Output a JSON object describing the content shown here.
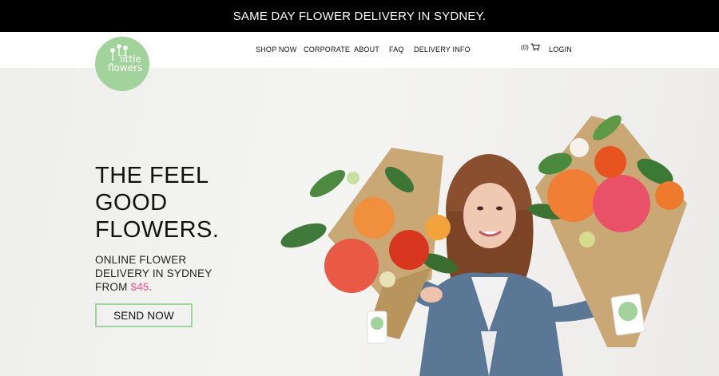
{
  "announcement": "SAME DAY FLOWER DELIVERY IN SYDNEY.",
  "logo": {
    "line1": "little",
    "line2": "flowers"
  },
  "nav": {
    "items": [
      "SHOP NOW",
      "CORPORATE",
      "ABOUT",
      "FAQ",
      "DELIVERY INFO"
    ],
    "cart_count": "(0)",
    "login": "LOGIN"
  },
  "hero": {
    "headline": [
      "THE FEEL",
      "GOOD",
      "FLOWERS."
    ],
    "sub": [
      "ONLINE FLOWER",
      "DELIVERY IN SYDNEY",
      "FROM "
    ],
    "price": "$45.",
    "cta": "SEND NOW"
  },
  "colors": {
    "brand_green": "#a3d39c",
    "price_pink": "#e580a8",
    "topbar": "#000000"
  }
}
